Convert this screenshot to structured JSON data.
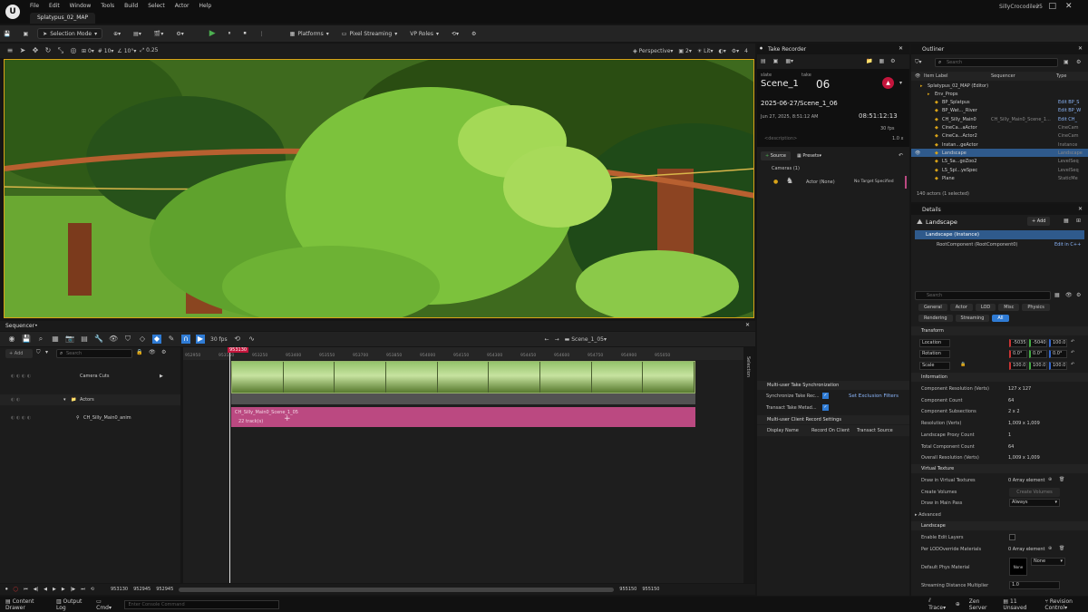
{
  "title_bar": {
    "menus": [
      "File",
      "Edit",
      "Window",
      "Tools",
      "Build",
      "Select",
      "Actor",
      "Help"
    ],
    "tab": "Splatypus_02_MAP",
    "project": "SillyCrocodile25"
  },
  "toolbar": {
    "selection_mode": "Selection Mode",
    "platforms": "Platforms",
    "pixel_streaming": "Pixel Streaming",
    "vp_roles": "VP Roles"
  },
  "viewport_toolbar": {
    "snap_translate": "0",
    "snap_rotate": "10",
    "snap_angle": "10°",
    "snap_scale": "0.25",
    "perspective": "Perspective",
    "lit": "Lit",
    "count": "2",
    "right_num": "4"
  },
  "sequencer": {
    "tab": "Sequencer•",
    "fps": "30 fps",
    "breadcrumb": "Scene_1_05",
    "add": "+ Add",
    "search_placeholder": "Search",
    "tracks": [
      {
        "name": "Camera Cuts"
      },
      {
        "name": "Actors"
      },
      {
        "name": "CH_Silly_Main0_anim"
      }
    ],
    "ruler_ticks": [
      "952950",
      "953150",
      "953250",
      "953400",
      "953550",
      "953700",
      "953850",
      "954000",
      "954150",
      "954300",
      "954450",
      "954600",
      "954750",
      "954900",
      "955050"
    ],
    "playhead": "953130",
    "section_title": "CH_Silly_Main0_Scene_1_05",
    "section_tracks": "22 track(s)",
    "selection_label": "Selection",
    "footer_time": "953130",
    "footer_start": "952945",
    "footer_start2": "952945",
    "footer_end": "955150",
    "footer_end2": "955150"
  },
  "take_recorder": {
    "tab": "Take Recorder",
    "slate_label": "slate",
    "take_label": "take",
    "slate": "Scene_1",
    "take": "06",
    "path": "2025-06-27/Scene_1_06",
    "date": "Jun 27, 2025, 8:51:12 AM",
    "timecode": "08:51:12:13",
    "fps": "30 fps",
    "scale": "1.0 x",
    "description": "<description>",
    "source_btn": "Source",
    "presets_btn": "Presets",
    "cameras": "Cameras (1)",
    "actor": "Actor (None)",
    "target": "No Target Specified",
    "sync_header": "Multi-user Take Synchronization",
    "sync_take": "Synchronize Take Rec...",
    "transact_take": "Transact Take Metad...",
    "set_exclusion": "Set Exclusion Filters",
    "client_header": "Multi-user Client Record Settings",
    "col_display": "Display Name",
    "col_record": "Record On Client",
    "col_transact": "Transact Source"
  },
  "outliner": {
    "tab": "Outliner",
    "search_placeholder": "Search",
    "col_label": "Item Label",
    "col_sequencer": "Sequencer",
    "col_type": "Type",
    "rows": [
      {
        "name": "Splatypus_02_MAP (Editor)",
        "type": ""
      },
      {
        "name": "Env_Props",
        "type": ""
      },
      {
        "name": "BP_Splatpus",
        "type": "Edit BP_S"
      },
      {
        "name": "BP_Wat..._River",
        "type": "Edit BP_W"
      },
      {
        "name": "CH_Silly_Main0",
        "type": "Edit CH_"
      },
      {
        "name": "CineCa...aActor",
        "type": "CineCam"
      },
      {
        "name": "CineCa...Actor2",
        "type": "CineCam"
      },
      {
        "name": "Instan...geActor",
        "type": "Instance"
      },
      {
        "name": "Landscape",
        "type": "Landscape"
      },
      {
        "name": "LS_Sa...goZoo2",
        "type": "LevelSeq"
      },
      {
        "name": "LS_Spl...yeSpec",
        "type": "LevelSeq"
      },
      {
        "name": "Plane",
        "type": "StaticMe"
      }
    ],
    "seq_link": "CH_Silly_Main0_Scene_1...",
    "status": "140 actors (1 selected)"
  },
  "details": {
    "tab": "Details",
    "actor": "Landscape",
    "add": "+ Add",
    "instance": "Landscape (Instance)",
    "root": "RootComponent (RootComponent0)",
    "edit_cpp": "Edit in C++",
    "search_placeholder": "Search",
    "tabs_row1": [
      "General",
      "Actor",
      "LOD",
      "Misc",
      "Physics"
    ],
    "tabs_row2": [
      "Rendering",
      "Streaming",
      "All"
    ],
    "transform": "Transform",
    "location": {
      "label": "Location",
      "x": "-5035",
      "y": "-5040",
      "z": "100.0"
    },
    "rotation": {
      "label": "Rotation",
      "x": "0.0°",
      "y": "0.0°",
      "z": "0.0°"
    },
    "scale": {
      "label": "Scale",
      "x": "100.0",
      "y": "100.0",
      "z": "100.0"
    },
    "information": "Information",
    "info_rows": [
      {
        "k": "Component Resolution (Verts)",
        "v": "127 x 127"
      },
      {
        "k": "Component Count",
        "v": "64"
      },
      {
        "k": "Component Subsections",
        "v": "2 x 2"
      },
      {
        "k": "Resolution (Verts)",
        "v": "1,009 x 1,009"
      },
      {
        "k": "Landscape Proxy Count",
        "v": "1"
      },
      {
        "k": "Total Component Count",
        "v": "64"
      },
      {
        "k": "Overall Resolution (Verts)",
        "v": "1,009 x 1,009"
      }
    ],
    "virtual_texture": "Virtual Texture",
    "draw_vt": "Draw in Virtual Textures",
    "array_elem": "0 Array element",
    "create_volumes": "Create Volumes",
    "create_btn": "Create Volumes",
    "draw_main": "Draw in Main Pass",
    "always": "Always",
    "advanced": "Advanced",
    "landscape_sec": "Landscape",
    "enable_edit": "Enable Edit Layers",
    "per_lod": "Per LODOverride Materials",
    "array_elem2": "0 Array element",
    "default_phys": "Default Phys Material",
    "none": "None",
    "none_thumb": "None",
    "streaming_mult": "Streaming Distance Multiplier",
    "streaming_val": "1.0"
  },
  "status_bar": {
    "content_drawer": "Content Drawer",
    "output_log": "Output Log",
    "cmd": "Cmd",
    "console_placeholder": "Enter Console Command",
    "trace": "Trace",
    "zen": "Zen Server",
    "unsaved": "11 Unsaved",
    "revision": "Revision Control"
  },
  "colors": {
    "accent": "#2f7bd4",
    "anim_section": "#bb4981",
    "take_red": "#c4153c"
  }
}
